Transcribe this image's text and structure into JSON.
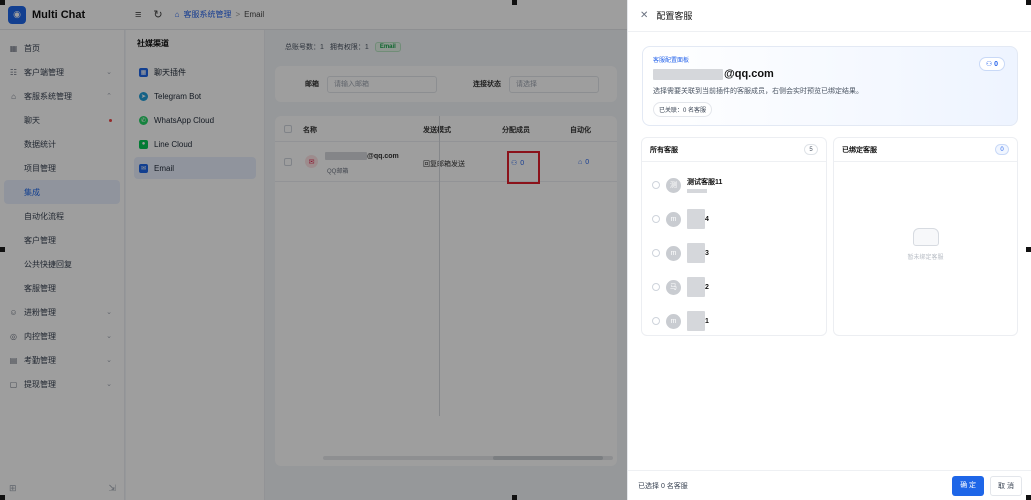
{
  "app": {
    "title": "Multi Chat",
    "logo_glyph": "◉"
  },
  "topbar": {
    "menu_icon": "≡",
    "refresh_icon": "↻",
    "breadcrumb": {
      "home_icon": "⌂",
      "parent": "客服系统管理",
      "separator": ">",
      "current": "Email"
    }
  },
  "sidebar": {
    "items": [
      {
        "icon": "▦",
        "label": "首页"
      },
      {
        "icon": "☷",
        "label": "客户端管理",
        "chev": "⌄"
      },
      {
        "icon": "⌂",
        "label": "客服系统管理",
        "chev": "⌃"
      },
      {
        "label": "聊天",
        "dot": true
      },
      {
        "label": "数据统计"
      },
      {
        "label": "项目管理"
      },
      {
        "label": "集成",
        "active": true
      },
      {
        "label": "自动化流程"
      },
      {
        "label": "客户管理"
      },
      {
        "label": "公共快捷回复"
      },
      {
        "label": "客服管理"
      },
      {
        "icon": "☺",
        "label": "进粉管理",
        "chev": "⌄"
      },
      {
        "icon": "◎",
        "label": "内控管理",
        "chev": "⌄"
      },
      {
        "icon": "▤",
        "label": "考勤管理",
        "chev": "⌄"
      },
      {
        "icon": "▢",
        "label": "提现管理",
        "chev": "⌄"
      }
    ],
    "bottom_left_icon": "⊞",
    "bottom_right_icon": "⇲"
  },
  "channels": {
    "title": "社媒渠道",
    "items": [
      {
        "label": "聊天插件",
        "icon": "▦",
        "color": "#1e66e8"
      },
      {
        "label": "Telegram Bot",
        "icon": "➤",
        "color": "#229ed9"
      },
      {
        "label": "WhatsApp Cloud",
        "icon": "✆",
        "color": "#25d366"
      },
      {
        "label": "Line Cloud",
        "icon": "●",
        "color": "#06c755"
      },
      {
        "label": "Email",
        "icon": "✉",
        "color": "#1e66e8",
        "active": true
      }
    ]
  },
  "main": {
    "stats": {
      "total": "总账号数：1",
      "owned": "拥有权限：1",
      "tag": "Email"
    },
    "filters": {
      "email_label": "邮箱",
      "email_placeholder": "请输入邮箱",
      "status_label": "连接状态",
      "status_placeholder": "请选择"
    },
    "table": {
      "headers": {
        "name": "名称",
        "mode": "发送模式",
        "assigned": "分配成员",
        "automation": "自动化"
      },
      "row": {
        "email_suffix": "@qq.com",
        "sub": "QQ邮箱",
        "mode": "回复邮箱发送",
        "assigned": "0",
        "automation": "0"
      }
    }
  },
  "drawer": {
    "title": "配置客服",
    "hero": {
      "label": "客服配置面板",
      "email_suffix": "@qq.com",
      "desc": "选择需要关联到当前插件的客服成员，右侧会实时预览已绑定结果。",
      "chip": "已关联：0 名客服",
      "count": "0"
    },
    "all": {
      "title": "所有客服",
      "count": "5",
      "agents": [
        {
          "avatar": "测",
          "name": "测试客服11"
        },
        {
          "avatar": "m",
          "name": "4"
        },
        {
          "avatar": "m",
          "name": "3"
        },
        {
          "avatar": "马",
          "name": "2"
        },
        {
          "avatar": "m",
          "name": "1"
        }
      ]
    },
    "bound": {
      "title": "已绑定客服",
      "count": "0",
      "empty": "暂未绑定客服"
    },
    "footer": {
      "selected": "已选择 0 名客服",
      "confirm": "确 定",
      "cancel": "取 消"
    }
  },
  "colors": {
    "accent": "#1e66e8",
    "highlight": "#e11d2a",
    "success": "#16a34a"
  }
}
